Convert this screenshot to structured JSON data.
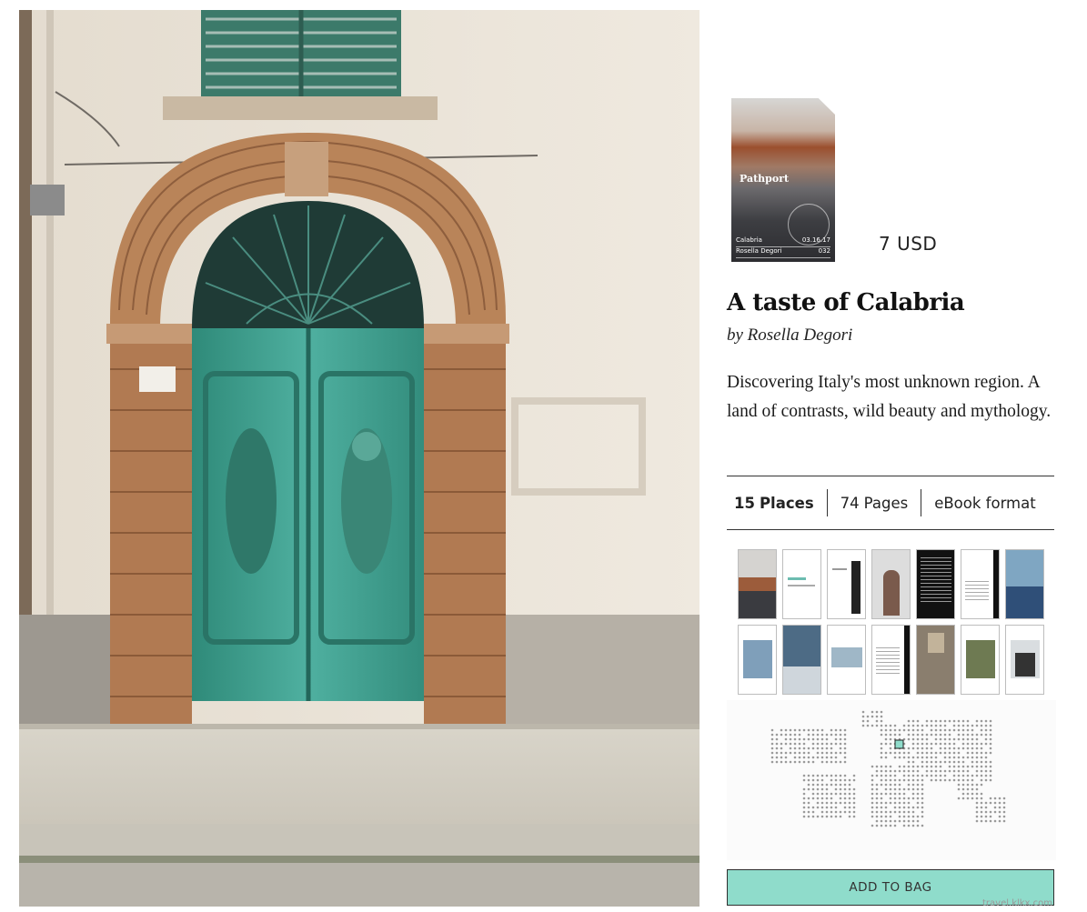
{
  "product": {
    "cover": {
      "brand": "Pathport",
      "row1_left": "Calabria",
      "row1_right": "03.16.17",
      "row2_left": "Rosella Degori",
      "row2_right": "032"
    },
    "price": "7 USD",
    "title": "A taste of Calabria",
    "author": "by Rosella Degori",
    "description": "Discovering Italy's most unknown region. A land of contrasts, wild beauty and mythology."
  },
  "stats": {
    "places_count": "15",
    "places_label": "Places",
    "pages_count": "74",
    "pages_label": "Pages",
    "format": "eBook format"
  },
  "preview_pages": [
    {
      "name": "page-cover"
    },
    {
      "name": "page-title"
    },
    {
      "name": "page-calabria"
    },
    {
      "name": "page-author"
    },
    {
      "name": "page-text-dark"
    },
    {
      "name": "page-itinerary"
    },
    {
      "name": "page-coast"
    },
    {
      "name": "page-street"
    },
    {
      "name": "page-harbor"
    },
    {
      "name": "page-landscape"
    },
    {
      "name": "page-listing"
    },
    {
      "name": "page-church"
    },
    {
      "name": "page-hills"
    },
    {
      "name": "page-ruins"
    }
  ],
  "map": {
    "highlight_region": "Italy",
    "highlight_color": "#8fdccb",
    "dot_color": "#9a9a9a"
  },
  "actions": {
    "add_to_bag": "ADD TO BAG"
  },
  "watermark": "travel.klkx.com",
  "colors": {
    "accent": "#8fdccb",
    "door": "#3f9e8c",
    "brick": "#b5764e",
    "wall": "#ebe4d8"
  }
}
